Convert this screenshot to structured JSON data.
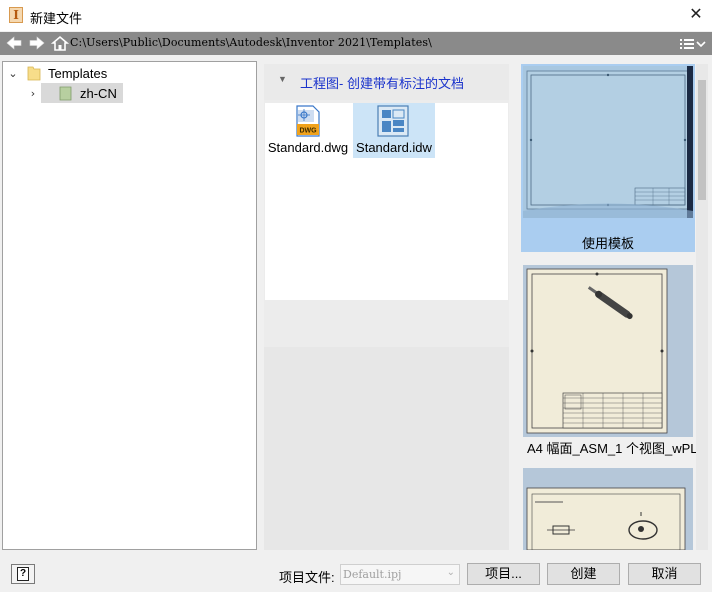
{
  "window": {
    "title": "新建文件",
    "close_icon": "close-icon"
  },
  "pathbar": {
    "back_icon": "back-arrow-icon",
    "forward_icon": "forward-arrow-icon",
    "home_icon": "home-icon",
    "path": "C:\\Users\\Public\\Documents\\Autodesk\\Inventor 2021\\Templates\\",
    "view_menu_icon": "view-list-menu-icon"
  },
  "tree": {
    "items": [
      {
        "label": "Templates",
        "expanded": true,
        "icon": "folder-icon"
      },
      {
        "label": "zh-CN",
        "expanded": false,
        "icon": "folder-icon",
        "selected": true
      }
    ]
  },
  "section": {
    "title": "工程图- 创建带有标注的文档",
    "collapse_icon": "collapse-triangle-icon"
  },
  "files": [
    {
      "label": "Standard.dwg",
      "icon": "dwg-file-icon",
      "badge": "DWG",
      "selected": false
    },
    {
      "label": "Standard.idw",
      "icon": "idw-file-icon",
      "selected": true
    }
  ],
  "previews": [
    {
      "label": "使用模板",
      "selected": true
    },
    {
      "label": "A4 幅面_ASM_1 个视图_wPL",
      "selected": false
    },
    {
      "label": "",
      "selected": false
    }
  ],
  "bottom": {
    "help_icon": "help-icon",
    "project_label": "项目文件:",
    "project_value": "Default.ipj",
    "projects_button": "项目...",
    "create_button": "创建",
    "cancel_button": "取消"
  },
  "colors": {
    "section_title": "#1a33cc",
    "selection": "#cce4f7",
    "preview_selected": "#aacdf0",
    "pathbar": "#8a8a8a"
  }
}
